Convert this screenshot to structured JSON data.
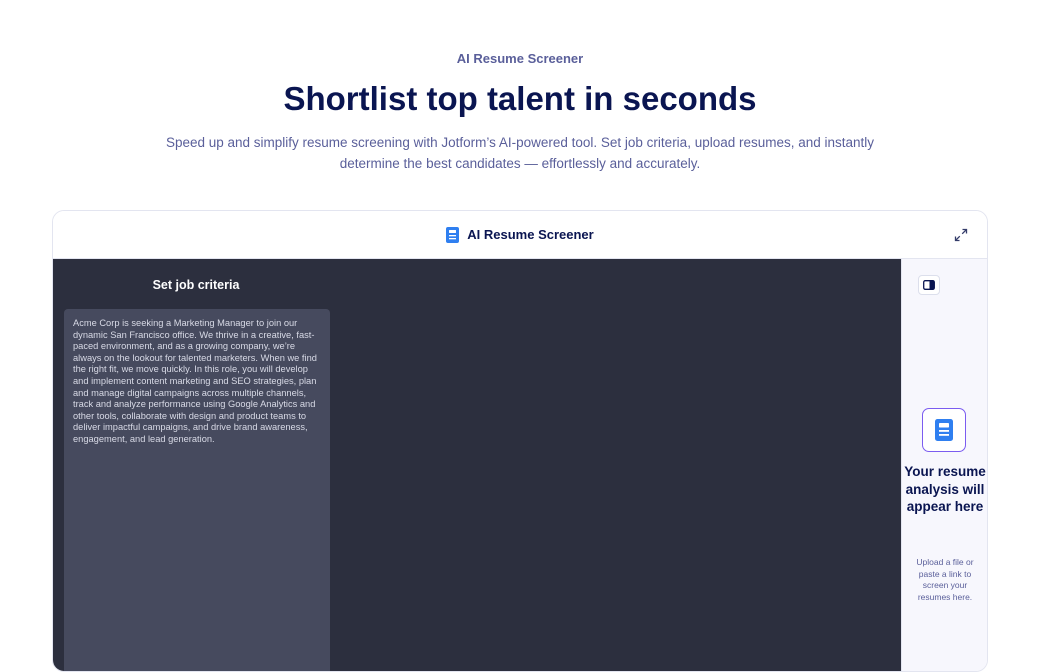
{
  "hero": {
    "eyebrow": "AI Resume Screener",
    "headline": "Shortlist top talent in seconds",
    "subtext": "Speed up and simplify resume screening with Jotform’s AI-powered tool. Set job criteria, upload resumes, and instantly determine the best candidates — effortlessly and accurately."
  },
  "panel": {
    "title": "AI Resume Screener",
    "icons": {
      "title_icon": "resume-document-icon",
      "expand": "expand-icon",
      "sidebar_toggle": "sidebar-toggle-icon",
      "result": "resume-document-icon"
    },
    "criteria": {
      "label": "Set job criteria",
      "text": "Acme Corp is seeking a Marketing Manager to join our dynamic San Francisco office. We thrive in a creative, fast-paced environment, and as a growing company, we’re always on the lookout for talented marketers. When we find the right fit, we move quickly. In this role, you will develop and implement content marketing and SEO strategies, plan and manage digital campaigns across multiple channels, track and analyze performance using Google Analytics and other tools, collaborate with design and product teams to deliver impactful campaigns, and drive brand awareness, engagement, and lead generation."
    },
    "result": {
      "title": "Your resume analysis will appear here",
      "description": "Upload a file or paste a link to screen your resumes here."
    }
  },
  "colors": {
    "heading": "#0a1551",
    "muted": "#5a5f9a",
    "dark_bg": "#2c2f3e",
    "textarea_bg": "#464a5e",
    "accent_blue": "#2f7ff0",
    "accent_purple": "#7b5cf0"
  }
}
